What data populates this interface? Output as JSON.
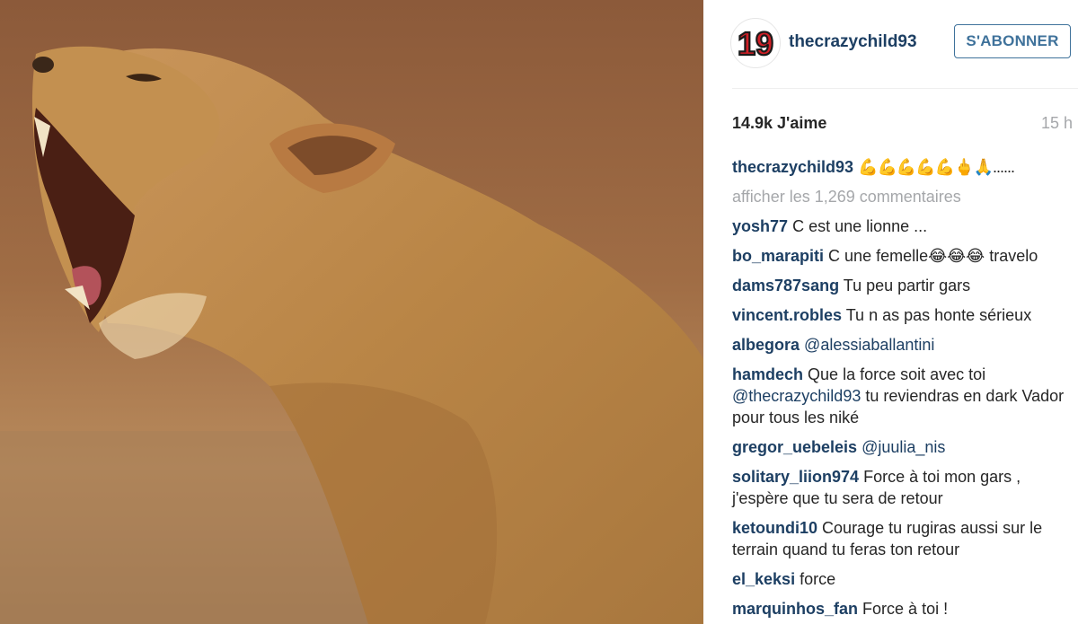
{
  "post": {
    "image_subject": "lioness-roaring"
  },
  "header": {
    "avatar_text": "19",
    "username": "thecrazychild93",
    "follow_label": "S'ABONNER"
  },
  "stats": {
    "likes": "14.9k J'aime",
    "time": "15 h"
  },
  "caption": {
    "user": "thecrazychild93",
    "text": "💪💪💪💪💪🖕🙏......"
  },
  "load_more": "afficher les 1,269 commentaires",
  "comments": [
    {
      "user": "yosh77",
      "text": "C est une lionne ..."
    },
    {
      "user": "bo_marapiti",
      "text": "C une femelle😂😂😂 travelo"
    },
    {
      "user": "dams787sang",
      "text": "Tu peu partir gars"
    },
    {
      "user": "vincent.robles",
      "text": "Tu n as pas honte sérieux"
    },
    {
      "user": "albegora",
      "mention": "@alessiaballantini",
      "text": ""
    },
    {
      "user": "hamdech",
      "text": "Que la force soit avec toi",
      "mention": "@thecrazychild93",
      "text2": "tu reviendras en dark Vador pour tous les niké"
    },
    {
      "user": "gregor_uebeleis",
      "mention": "@juulia_nis",
      "text": ""
    },
    {
      "user": "solitary_liion974",
      "text": "Force à toi mon gars , j'espère que tu sera de retour"
    },
    {
      "user": "ketoundi10",
      "text": "Courage tu rugiras aussi sur le terrain quand tu feras ton retour"
    },
    {
      "user": "el_keksi",
      "text": "force"
    },
    {
      "user": "marquinhos_fan",
      "text": "Force à toi !"
    }
  ],
  "colors": {
    "username_blue": "#1d3f63",
    "follow_blue": "#3f729b",
    "muted_gray": "#a5a7aa"
  }
}
